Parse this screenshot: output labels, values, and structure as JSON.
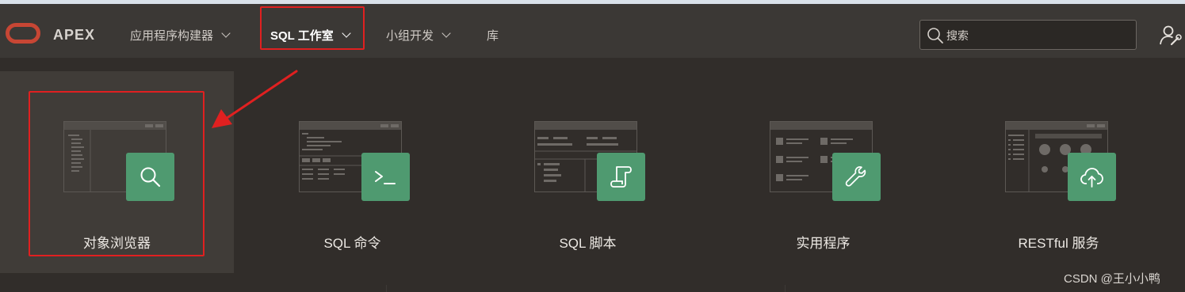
{
  "header": {
    "brand": "APEX",
    "nav": [
      {
        "label": "应用程序构建器",
        "has_menu": true,
        "active": false
      },
      {
        "label": "SQL 工作室",
        "has_menu": true,
        "active": true
      },
      {
        "label": "小组开发",
        "has_menu": true,
        "active": false
      },
      {
        "label": "库",
        "has_menu": false,
        "active": false
      }
    ],
    "search": {
      "placeholder": "搜索",
      "value": ""
    }
  },
  "cards": [
    {
      "label": "对象浏览器",
      "icon": "search-icon",
      "selected": true
    },
    {
      "label": "SQL 命令",
      "icon": "terminal-icon",
      "selected": false
    },
    {
      "label": "SQL 脚本",
      "icon": "scroll-icon",
      "selected": false
    },
    {
      "label": "实用程序",
      "icon": "wrench-icon",
      "selected": false
    },
    {
      "label": "RESTful 服务",
      "icon": "cloud-upload-icon",
      "selected": false
    }
  ],
  "watermark": "CSDN @王小小鸭",
  "colors": {
    "header_bg": "#3b3835",
    "page_bg": "#312d2a",
    "tile_green": "#4f9a70",
    "annotation_red": "#e02020",
    "oracle_red": "#c74634"
  }
}
